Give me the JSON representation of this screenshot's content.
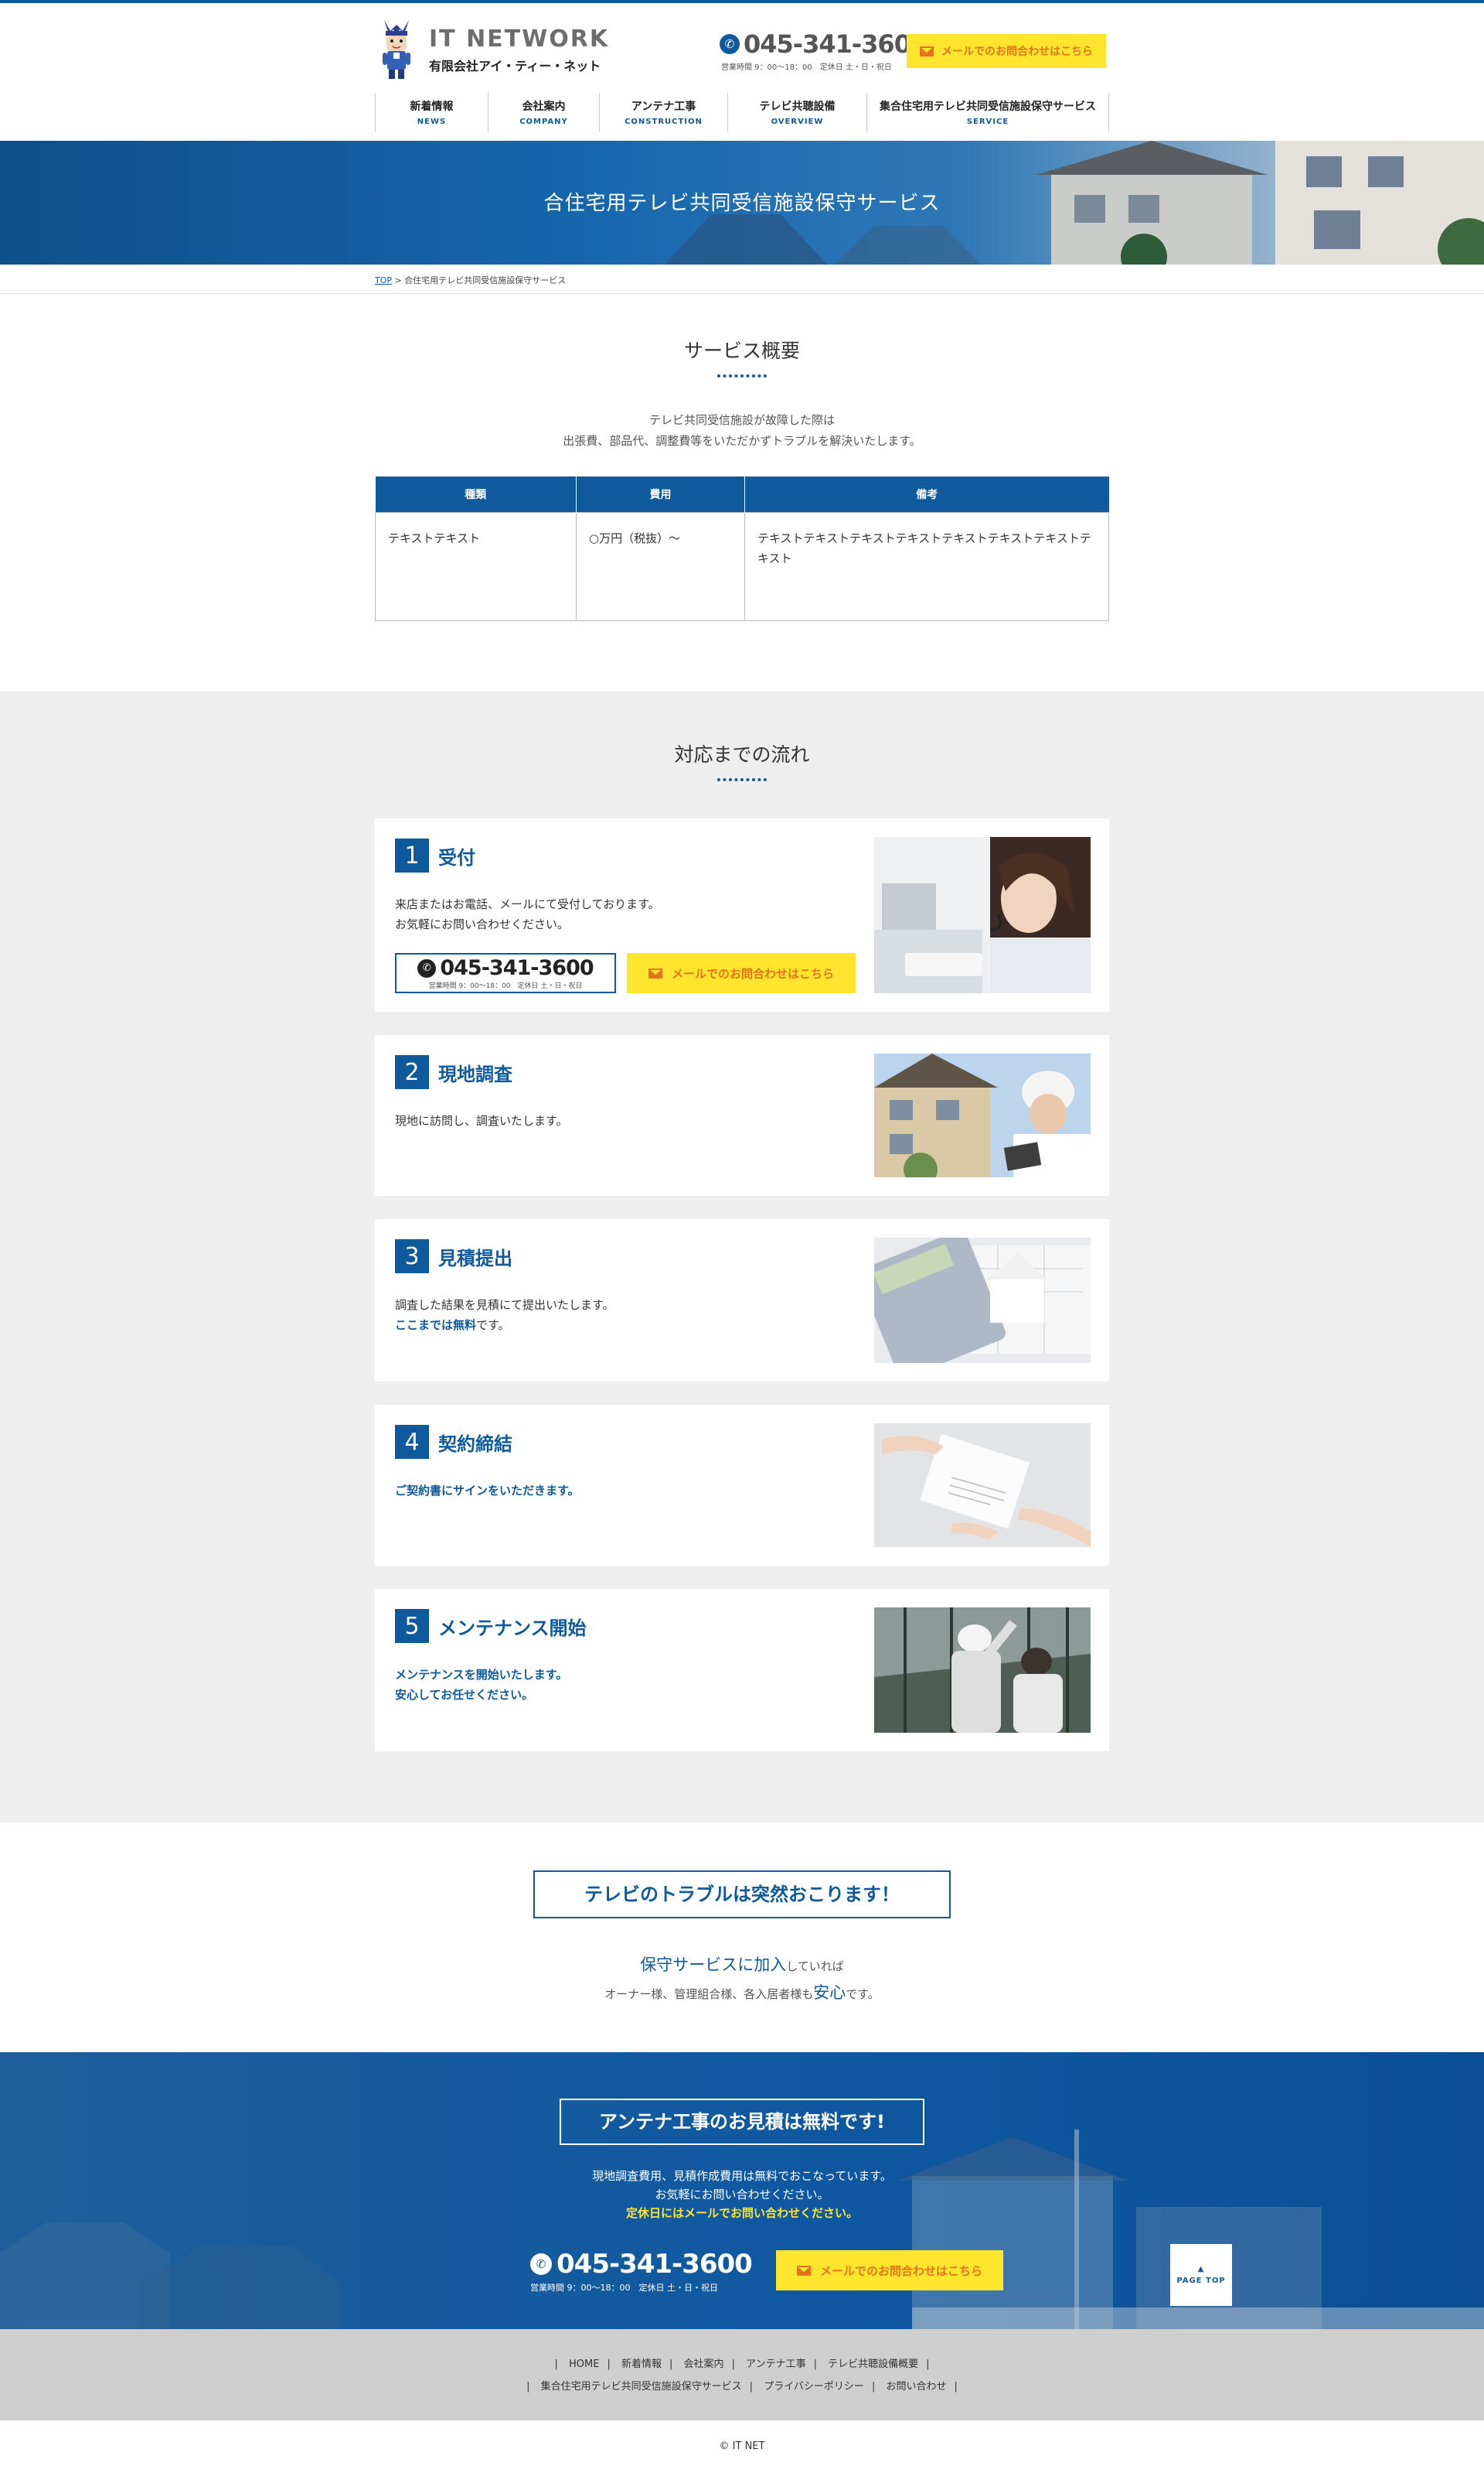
{
  "header": {
    "logo_en": "IT NETWORK",
    "logo_ja": "有限会社アイ・ティー・ネット",
    "tel": "045-341-3600",
    "tel_hours": "営業時間 9：00〜18：00　定休日 土・日・祝日",
    "mail_button": "メールでのお問合わせはこちら",
    "nav": [
      {
        "ja": "新着情報",
        "en": "NEWS"
      },
      {
        "ja": "会社案内",
        "en": "COMPANY"
      },
      {
        "ja": "アンテナ工事",
        "en": "CONSTRUCTION"
      },
      {
        "ja": "テレビ共聴設備",
        "en": "OVERVIEW"
      },
      {
        "ja": "集合住宅用テレビ共同受信施設保守サービス",
        "en": "SERVICE"
      }
    ]
  },
  "hero": {
    "title": "合住宅用テレビ共同受信施設保守サービス"
  },
  "breadcrumb": {
    "top": "TOP",
    "separator": ">",
    "current": "合住宅用テレビ共同受信施設保守サービス"
  },
  "overview": {
    "title": "サービス概要",
    "lead_1": "テレビ共同受信施設が故障した際は",
    "lead_2": "出張費、部品代、調整費等をいただかずトラブルを解決いたします。",
    "table": {
      "headers": [
        "種類",
        "費用",
        "備考"
      ],
      "rows": [
        [
          "テキストテキスト",
          "○万円（税抜）〜",
          "テキストテキストテキストテキストテキストテキストテキストテキスト"
        ]
      ]
    }
  },
  "flow": {
    "title": "対応までの流れ",
    "steps": [
      {
        "num": "1",
        "title": "受付",
        "text_1": "来店またはお電話、メールにて受付しております。",
        "text_2": "お気軽にお問い合わせください。"
      },
      {
        "num": "2",
        "title": "現地調査",
        "text_1": "現地に訪問し、調査いたします。"
      },
      {
        "num": "3",
        "title": "見積提出",
        "text_1": "調査した結果を見積にて提出いたします。",
        "text_2_hl": "ここまでは無料",
        "text_2_rest": "です。"
      },
      {
        "num": "4",
        "title": "契約締結",
        "text_1": "ご契約書にサインをいただきます。"
      },
      {
        "num": "5",
        "title": "メンテナンス開始",
        "text_1": "メンテナンスを開始いたします。",
        "text_2": "安心してお任せください。"
      }
    ],
    "step1_tel": "045-341-3600",
    "step1_hours": "営業時間 9：00〜18：00　定休日 土・日・祝日",
    "step1_mail": "メールでのお問合わせはこちら"
  },
  "trouble": {
    "heading": "テレビのトラブルは突然おこります！",
    "line1_big": "保守サービスに加入",
    "line1_small": "していれば",
    "line2_pre": "オーナー様、管理組合様、各入居者様も",
    "line2_big": "安心",
    "line2_post": "です。"
  },
  "cta": {
    "heading": "アンテナ工事のお見積は無料です!",
    "line1": "現地調査費用、見積作成費用は無料でおこなっています。",
    "line2": "お気軽にお問い合わせください。",
    "line3": "定休日にはメールでお問い合わせください。",
    "tel": "045-341-3600",
    "hours": "営業時間 9：00〜18：00　定休日 土・日・祝日",
    "mail": "メールでのお問合わせはこちら",
    "pagetop": "PAGE TOP"
  },
  "footer": {
    "nav_row1": [
      "HOME",
      "新着情報",
      "会社案内",
      "アンテナ工事",
      "テレビ共聴設備概要"
    ],
    "nav_row2": [
      "集合住宅用テレビ共同受信施設保守サービス",
      "プライバシーポリシー",
      "お問い合わせ"
    ],
    "copyright": "© IT NET"
  },
  "colors": {
    "primary": "#0e5a9c",
    "accent": "#ffe52e",
    "accent_text": "#e5741a",
    "flow_bg": "#eeeeee",
    "footer_bg": "#cfcfcf"
  }
}
